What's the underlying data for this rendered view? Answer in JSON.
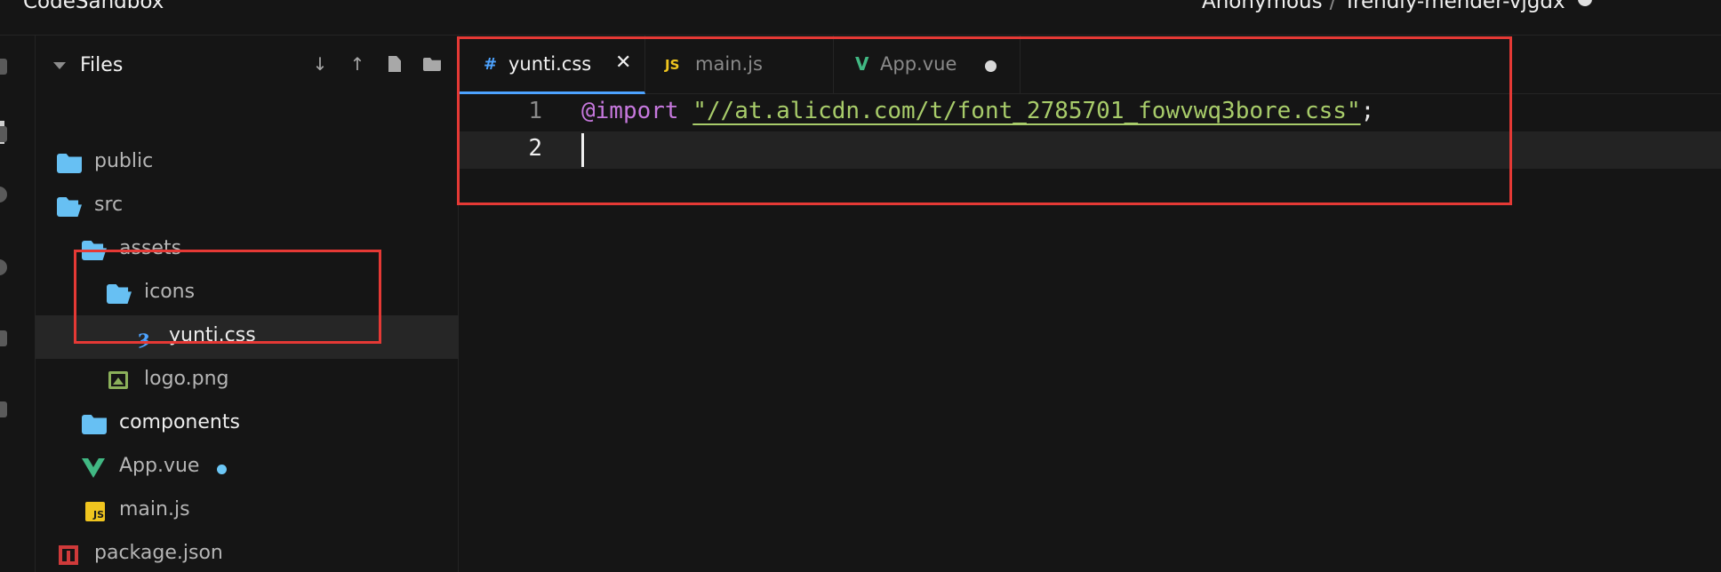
{
  "app": {
    "brand": "CodeSandbox",
    "owner": "Anonymous",
    "separator": "/",
    "sandbox_name": "Trendly-mender-vjgdx"
  },
  "sidebar": {
    "title": "Files",
    "tree": [
      {
        "label": "public",
        "icon": "folder-icon",
        "depth": 0
      },
      {
        "label": "src",
        "icon": "folder-open-icon",
        "depth": 0
      },
      {
        "label": "assets",
        "icon": "folder-open-icon",
        "depth": 1
      },
      {
        "label": "icons",
        "icon": "folder-open-icon",
        "depth": 2
      },
      {
        "label": "yunti.css",
        "icon": "css-file-icon",
        "depth": 3,
        "selected": true
      },
      {
        "label": "logo.png",
        "icon": "image-file-icon",
        "depth": 2
      },
      {
        "label": "components",
        "icon": "folder-icon",
        "depth": 1
      },
      {
        "label": "App.vue",
        "icon": "vue-file-icon",
        "depth": 1,
        "modified": true
      },
      {
        "label": "main.js",
        "icon": "js-file-icon",
        "depth": 1
      },
      {
        "label": "package.json",
        "icon": "npm-file-icon",
        "depth": 0
      }
    ]
  },
  "editor": {
    "tabs": [
      {
        "label": "yunti.css",
        "icon_glyph": "#",
        "icon_color": "#4da3ff",
        "active": true,
        "close": "✕"
      },
      {
        "label": "main.js",
        "icon_glyph": "JS",
        "icon_color": "#f0c51f",
        "active": false
      },
      {
        "label": "App.vue",
        "icon_glyph": "V",
        "icon_color": "#41b883",
        "active": false,
        "modified": true
      }
    ],
    "lines": [
      {
        "number": "1",
        "keyword": "@import",
        "string": "\"//at.alicdn.com/t/font_2785701_fowvwq3bore.css\"",
        "punct": ";"
      },
      {
        "number": "2",
        "keyword": "",
        "string": "",
        "punct": ""
      }
    ]
  },
  "colors": {
    "accent": "#4da3ff",
    "annotation": "#e53935",
    "folder": "#67c0f3",
    "keyword": "#c678dd",
    "string": "#a8cc6a"
  }
}
